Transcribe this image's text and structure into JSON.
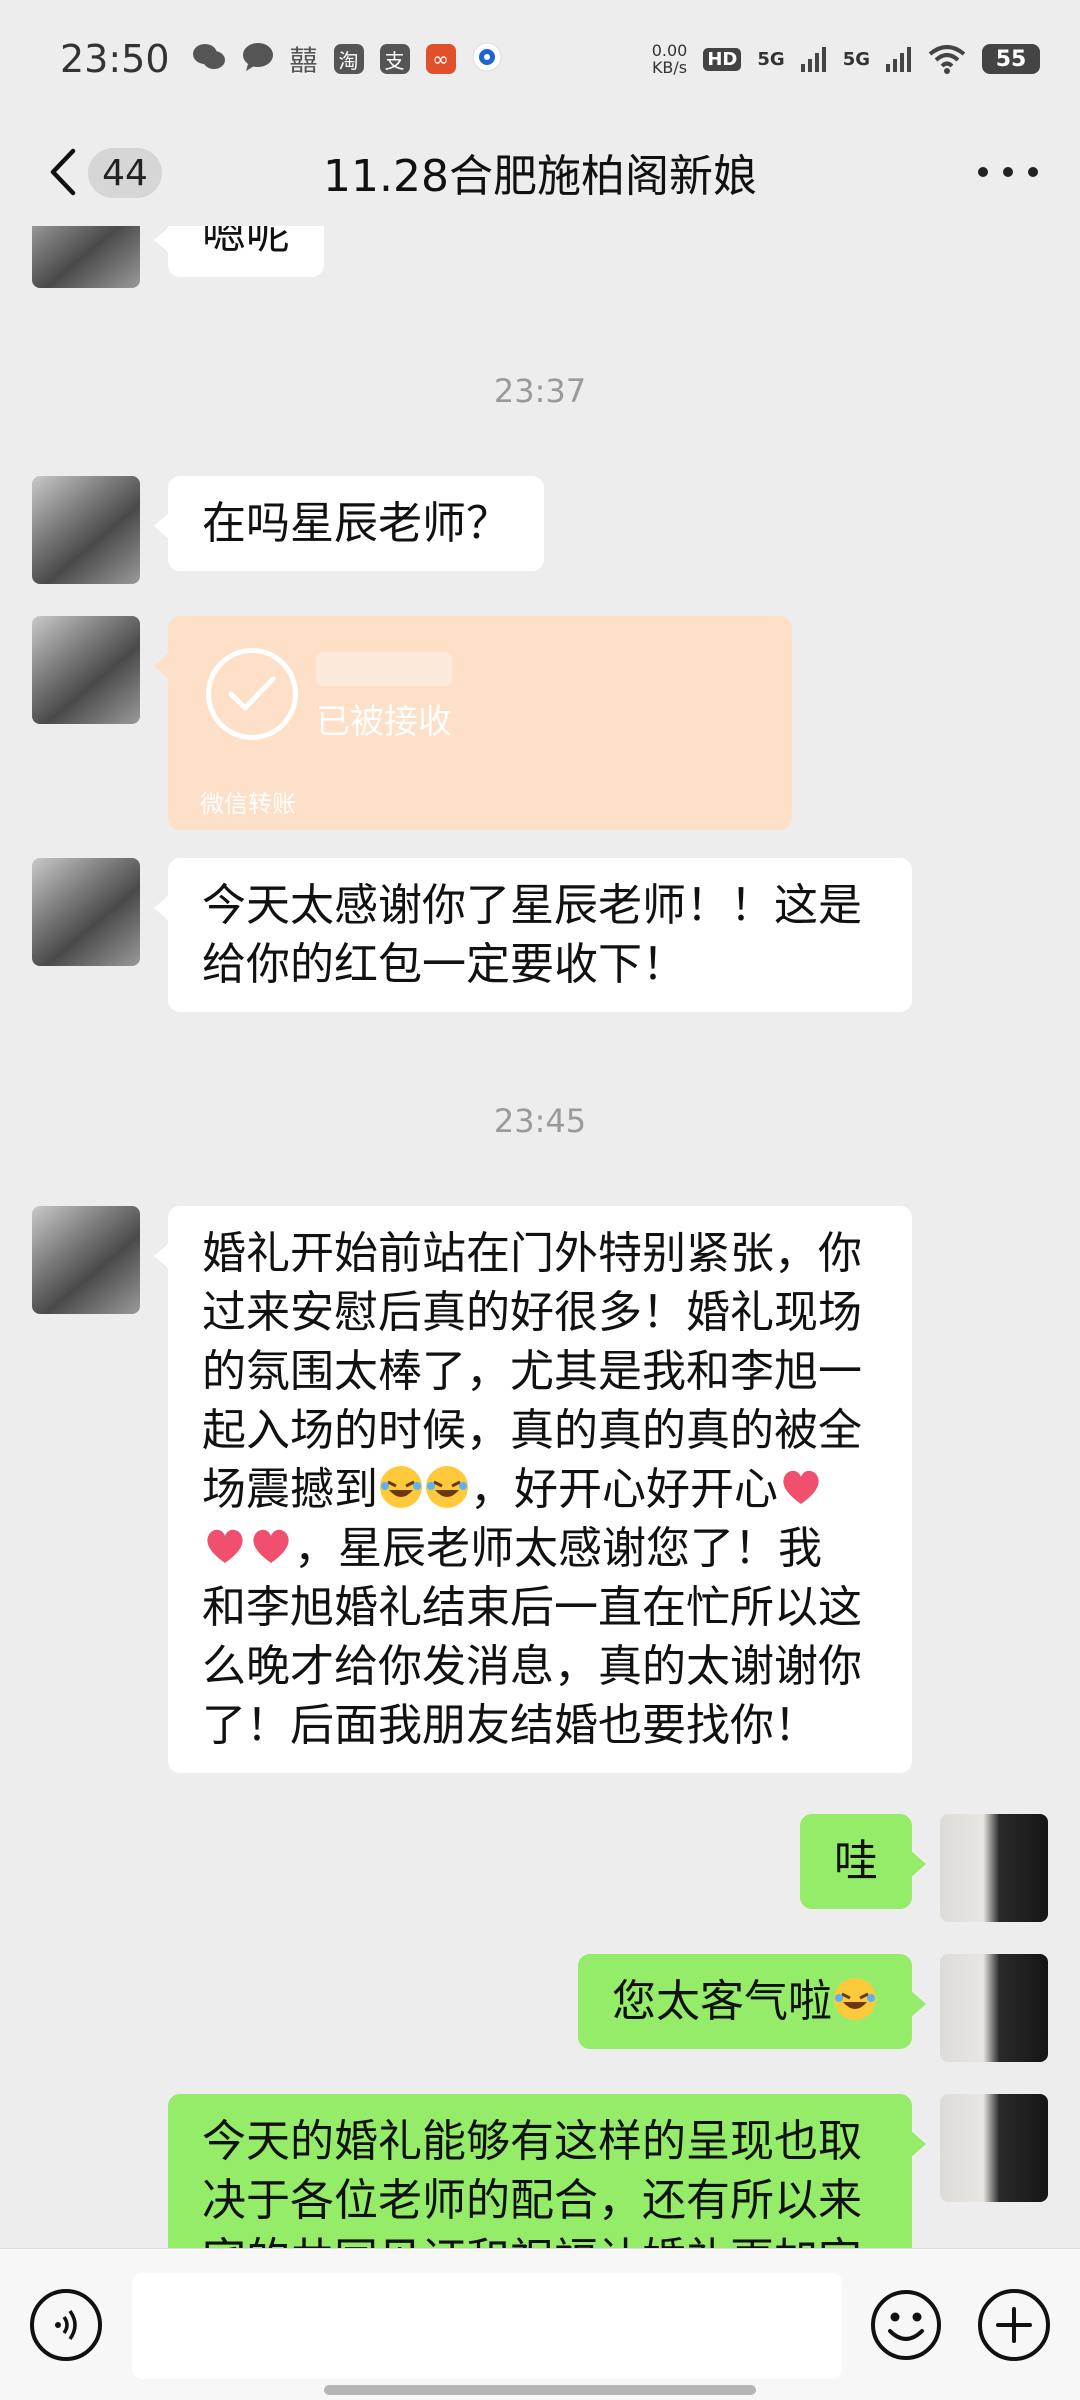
{
  "status_bar": {
    "time": "23:50",
    "net_speed_value": "0.00",
    "net_speed_unit": "KB/s",
    "hd_label": "HD",
    "signal1": "5G",
    "signal2": "5G",
    "battery": "55",
    "left_icons": [
      "wechat-icon",
      "message-icon",
      "marriage-app-icon",
      "taobao-icon",
      "alipay-icon",
      "app-orange-icon",
      "app-blue-icon"
    ]
  },
  "nav": {
    "unread_count": "44",
    "title": "11.28合肥施柏阁新娘"
  },
  "messages": {
    "m1": "嗯呢",
    "ts1": "23:37",
    "m2": "在吗星辰老师？",
    "transfer_status": "已被接收",
    "transfer_label": "微信转账",
    "m3_line1": "今天太感谢你了星辰老师！！这是",
    "m3_line2": "给你的红包一定要收下！",
    "ts2": "23:45",
    "m4_l1": "婚礼开始前站在门外特别紧张，你",
    "m4_l2": "过来安慰后真的好很多！婚礼现场",
    "m4_l3": "的氛围太棒了，尤其是我和李旭一",
    "m4_l4": "起入场的时候，真的真的真的被全",
    "m4_l5a": "场震撼到",
    "m4_l5b": "，好开心好开心",
    "m4_l6": "，星辰老师太感谢您了！我",
    "m4_l7": "和李旭婚礼结束后一直在忙所以这",
    "m4_l8": "么晚才给你发消息，真的太谢谢你",
    "m4_l9": "了！后面我朋友结婚也要找你！",
    "r1": "哇",
    "r2": "您太客气啦",
    "r3_l1": "今天的婚礼能够有这样的呈现也取",
    "r3_l2": "决于各位老师的配合，还有所以来",
    "r3_l3": "宾的共同见证和祝福让婚礼更加完"
  },
  "colors": {
    "background": "#ededed",
    "sent_bubble": "#95ec69",
    "received_bubble": "#ffffff",
    "transfer_card": "#fde0c7"
  }
}
